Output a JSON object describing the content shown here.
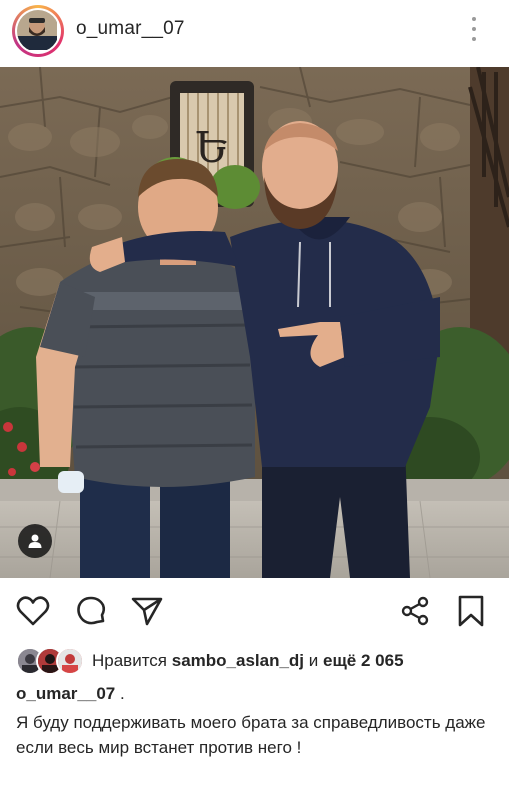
{
  "header": {
    "username": "o_umar__07"
  },
  "photo": {
    "sign_letter": "Ե"
  },
  "likes": {
    "prefix": "Нравится",
    "user": "sambo_aslan_dj",
    "connector": "и",
    "others": "ещё 2 065"
  },
  "caption": {
    "username": "o_umar__07",
    "separator": ".",
    "text": "Я буду поддерживать моего брата за справедливость даже если весь мир встанет против него !"
  },
  "icons": {
    "like": "heart-icon",
    "comment": "comment-icon",
    "share": "paper-plane-icon",
    "network": "share-nodes-icon",
    "save": "bookmark-icon",
    "menu": "more-vertical-icon",
    "tag": "user-tag-icon"
  },
  "colors": {
    "text": "#262626",
    "muted": "#9a9a9a",
    "background": "#ffffff"
  }
}
